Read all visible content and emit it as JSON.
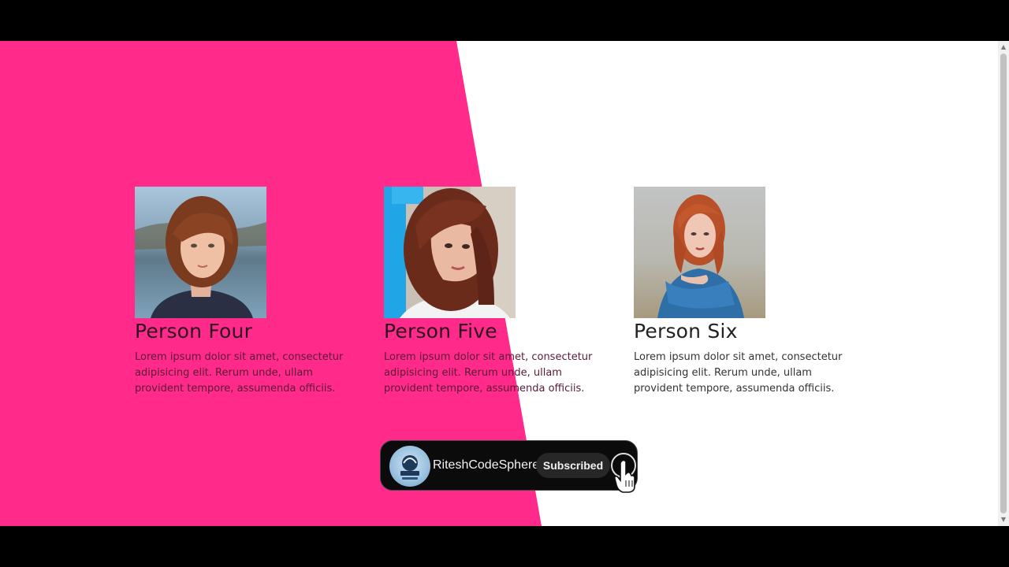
{
  "colors": {
    "pink": "#ff2a8a",
    "white": "#ffffff",
    "frame": "#000000"
  },
  "cards": [
    {
      "name": "Person Four",
      "description": "Lorem ipsum dolor sit amet, consectetur adipisicing elit. Rerum unde, ullam provident tempore, assumenda officiis.",
      "photo_icon": "portrait-photo-icon"
    },
    {
      "name": "Person Five",
      "description": "Lorem ipsum dolor sit amet, consectetur adipisicing elit. Rerum unde, ullam provident tempore, assumenda officiis.",
      "photo_icon": "portrait-photo-icon"
    },
    {
      "name": "Person Six",
      "description": "Lorem ipsum dolor sit amet, consectetur adipisicing elit. Rerum unde, ullam provident tempore, assumenda officiis.",
      "photo_icon": "portrait-photo-icon"
    }
  ],
  "subscribe_overlay": {
    "channel_name": "RiteshCodeSphere",
    "button_label": "Subscribed",
    "avatar_icon": "channel-logo-icon",
    "bell_icon": "bell-icon",
    "cursor_icon": "hand-pointer-icon"
  }
}
